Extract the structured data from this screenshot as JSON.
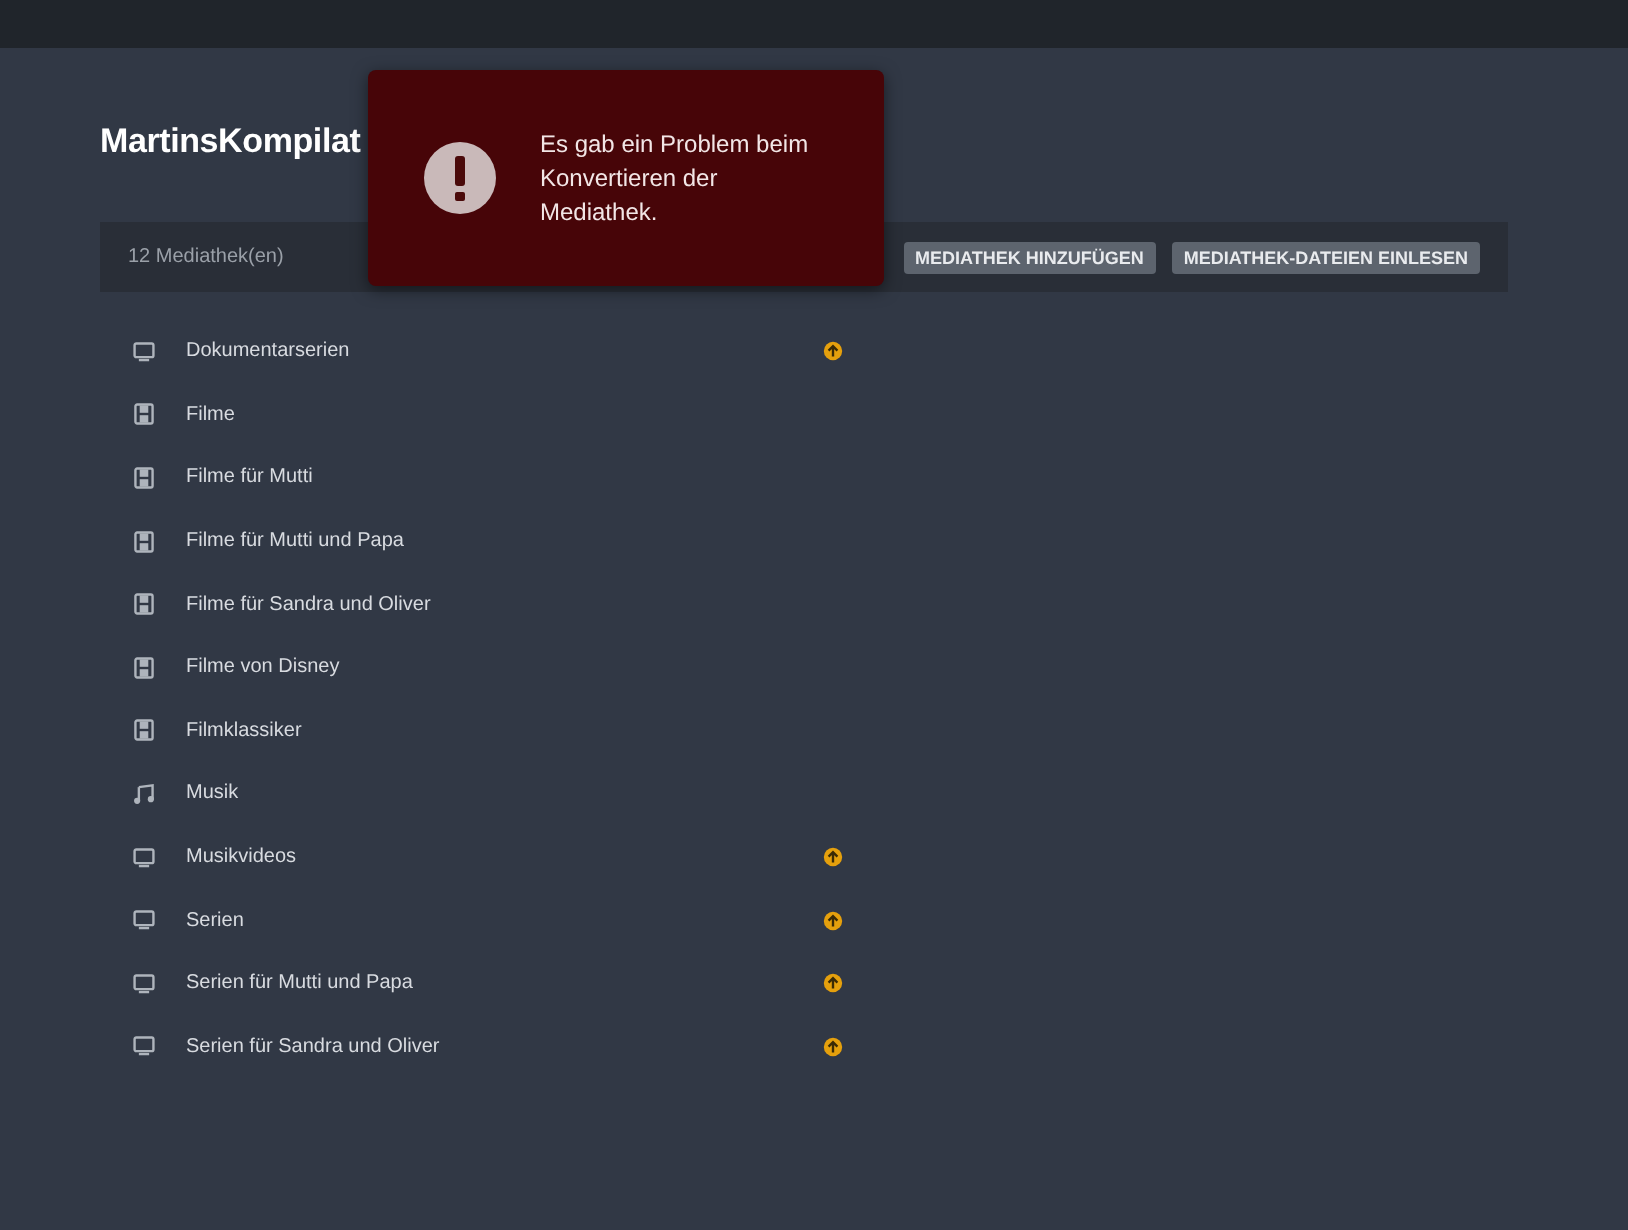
{
  "page_title": "MartinsKompilat",
  "toolbar": {
    "count": "12 Mediathek(en)",
    "buttons": [
      "MEDIATHEK HINZUFÜGEN",
      "MEDIATHEK-DATEIEN EINLESEN"
    ]
  },
  "libraries": [
    {
      "name": "Dokumentarserien",
      "kind": "tv",
      "update_available": true
    },
    {
      "name": "Filme",
      "kind": "film",
      "update_available": false
    },
    {
      "name": "Filme für Mutti",
      "kind": "film",
      "update_available": false
    },
    {
      "name": "Filme für Mutti und Papa",
      "kind": "film",
      "update_available": false
    },
    {
      "name": "Filme für Sandra und Oliver",
      "kind": "film",
      "update_available": false
    },
    {
      "name": "Filme von Disney",
      "kind": "film",
      "update_available": false
    },
    {
      "name": "Filmklassiker",
      "kind": "film",
      "update_available": false
    },
    {
      "name": "Musik",
      "kind": "music",
      "update_available": false
    },
    {
      "name": "Musikvideos",
      "kind": "tv",
      "update_available": true
    },
    {
      "name": "Serien",
      "kind": "tv",
      "update_available": true
    },
    {
      "name": "Serien für Mutti und Papa",
      "kind": "tv",
      "update_available": true
    },
    {
      "name": "Serien für Sandra und Oliver",
      "kind": "tv",
      "update_available": true
    }
  ],
  "error_toast": {
    "message": "Es gab ein Problem beim Konvertieren der Mediathek."
  }
}
